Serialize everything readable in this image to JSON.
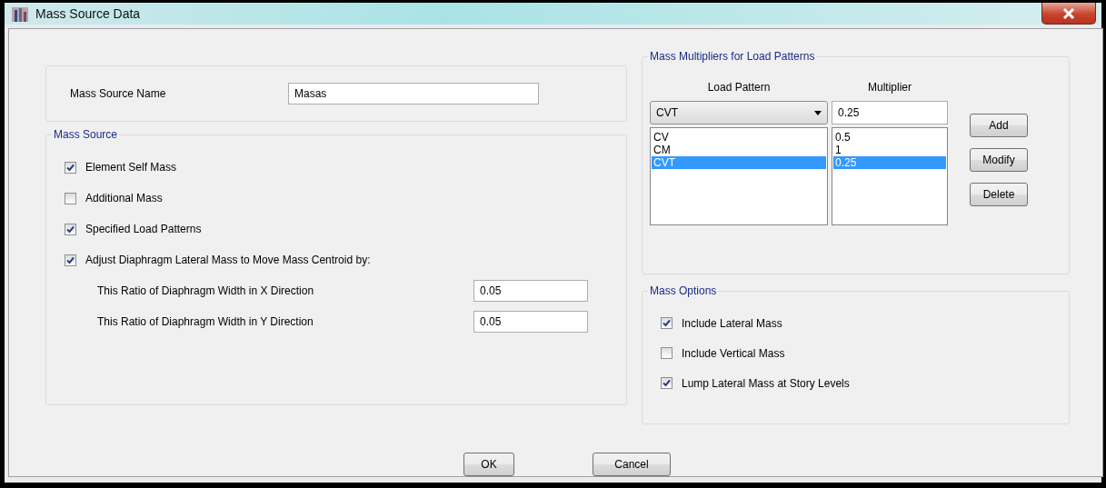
{
  "window": {
    "title": "Mass Source Data"
  },
  "mass_source_name": {
    "label": "Mass Source Name",
    "value": "Masas"
  },
  "mass_source": {
    "title": "Mass Source",
    "options": [
      {
        "label": "Element Self Mass",
        "checked": true
      },
      {
        "label": "Additional Mass",
        "checked": false
      },
      {
        "label": "Specified Load Patterns",
        "checked": true
      },
      {
        "label": "Adjust Diaphragm Lateral Mass to Move Mass Centroid by:",
        "checked": true
      }
    ],
    "ratios": [
      {
        "label": "This Ratio of Diaphragm Width in X Direction",
        "value": "0.05"
      },
      {
        "label": "This Ratio of Diaphragm Width in Y Direction",
        "value": "0.05"
      }
    ]
  },
  "mass_multipliers": {
    "title": "Mass Multipliers for Load Patterns",
    "column_headers": [
      "Load Pattern",
      "Multiplier"
    ],
    "load_pattern_value": "CVT",
    "multiplier_value": "0.25",
    "rows": [
      {
        "load_pattern": "CV",
        "multiplier": "0.5",
        "selected": false
      },
      {
        "load_pattern": "CM",
        "multiplier": "1",
        "selected": false
      },
      {
        "load_pattern": "CVT",
        "multiplier": "0.25",
        "selected": true
      }
    ],
    "buttons": [
      "Add",
      "Modify",
      "Delete"
    ]
  },
  "mass_options": {
    "title": "Mass Options",
    "options": [
      {
        "label": "Include Lateral Mass",
        "checked": true
      },
      {
        "label": "Include Vertical Mass",
        "checked": false
      },
      {
        "label": "Lump Lateral Mass at Story Levels",
        "checked": true
      }
    ]
  },
  "buttons": [
    "OK",
    "Cancel"
  ]
}
